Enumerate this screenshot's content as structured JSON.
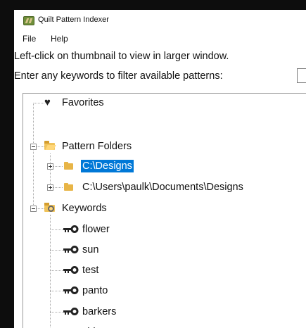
{
  "window": {
    "title": "Quilt Pattern Indexer"
  },
  "menu": {
    "items": [
      {
        "label": "File"
      },
      {
        "label": "Help"
      }
    ]
  },
  "instructions": {
    "thumbnail_hint": "Left-click on thumbnail to view in larger window.",
    "filter_label": "Enter any keywords to filter available patterns:",
    "filter_value": ""
  },
  "tree": {
    "favorites": {
      "label": "Favorites",
      "icon": "heart-icon"
    },
    "pattern_folders": {
      "label": "Pattern Folders",
      "icon": "open-folder-icon",
      "expanded": true,
      "children": [
        {
          "label": "C:\\Designs",
          "icon": "folder-icon",
          "selected": true,
          "collapsed": true
        },
        {
          "label": "C:\\Users\\paulk\\Documents\\Designs",
          "icon": "folder-icon",
          "selected": false,
          "collapsed": true
        }
      ]
    },
    "keywords": {
      "label": "Keywords",
      "icon": "keywords-icon",
      "expanded": true,
      "children": [
        {
          "label": "flower",
          "icon": "key-icon"
        },
        {
          "label": "sun",
          "icon": "key-icon"
        },
        {
          "label": "test",
          "icon": "key-icon"
        },
        {
          "label": "panto",
          "icon": "key-icon"
        },
        {
          "label": "barkers",
          "icon": "key-icon"
        },
        {
          "label": "chiwawa",
          "icon": "key-icon"
        }
      ]
    }
  },
  "colors": {
    "selection": "#0078d7",
    "folder": "#e8b547",
    "background": "#ffffff"
  }
}
